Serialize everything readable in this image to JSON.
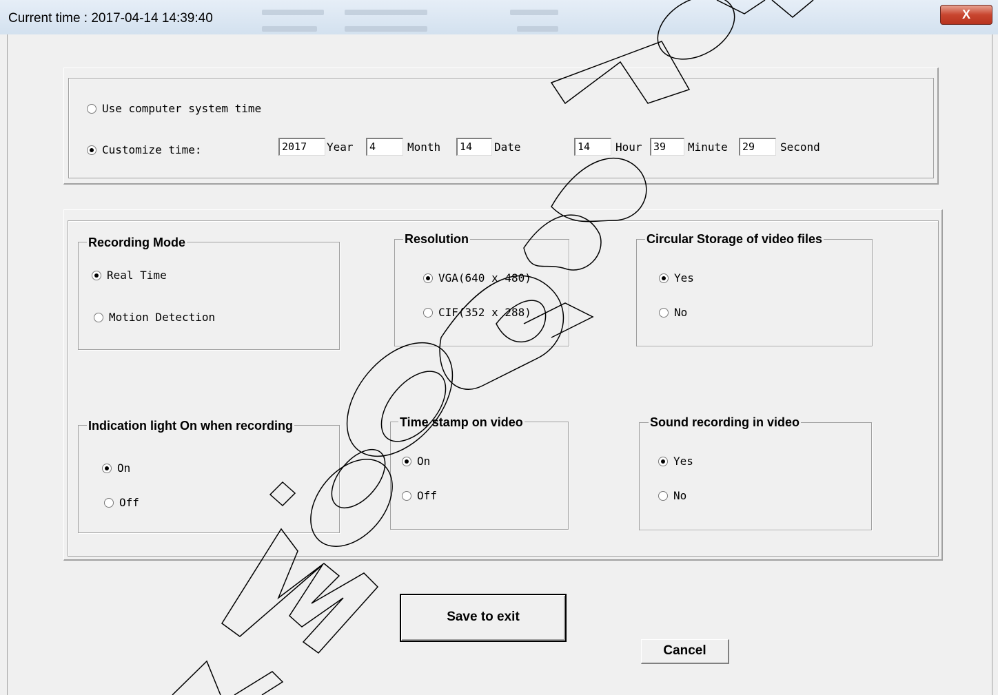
{
  "window": {
    "title": "Current time : 2017-04-14   14:39:40",
    "close_label": "X"
  },
  "time_panel": {
    "system_time_label": "Use computer system time",
    "system_time_selected": false,
    "custom_time_label": "Customize time:",
    "custom_time_selected": true,
    "fields": [
      {
        "value": "2017",
        "unit": "Year"
      },
      {
        "value": "4",
        "unit": "Month"
      },
      {
        "value": "14",
        "unit": "Date"
      },
      {
        "value": "14",
        "unit": "Hour"
      },
      {
        "value": "39",
        "unit": "Minute"
      },
      {
        "value": "29",
        "unit": "Second"
      }
    ]
  },
  "groups": {
    "recording_mode": {
      "title": "Recording Mode",
      "options": [
        {
          "label": "Real Time",
          "selected": true
        },
        {
          "label": "Motion Detection",
          "selected": false
        }
      ]
    },
    "resolution": {
      "title": "Resolution",
      "options": [
        {
          "label": "VGA(640 x 480)",
          "selected": true
        },
        {
          "label": "CIF(352 x 288)",
          "selected": false
        }
      ]
    },
    "circular_storage": {
      "title": "Circular Storage of video files",
      "options": [
        {
          "label": "Yes",
          "selected": true
        },
        {
          "label": "No",
          "selected": false
        }
      ]
    },
    "indication_light": {
      "title": "Indication light On when recording",
      "options": [
        {
          "label": "On",
          "selected": true
        },
        {
          "label": "Off",
          "selected": false
        }
      ]
    },
    "time_stamp": {
      "title": "Time stamp on video",
      "options": [
        {
          "label": "On",
          "selected": true
        },
        {
          "label": "Off",
          "selected": false
        }
      ]
    },
    "sound_recording": {
      "title": "Sound recording in video",
      "options": [
        {
          "label": "Yes",
          "selected": true
        },
        {
          "label": "No",
          "selected": false
        }
      ]
    }
  },
  "buttons": {
    "save_label": "Save to exit",
    "cancel_label": "Cancel"
  },
  "watermark": {
    "text": "www.wiseupshop.com"
  }
}
